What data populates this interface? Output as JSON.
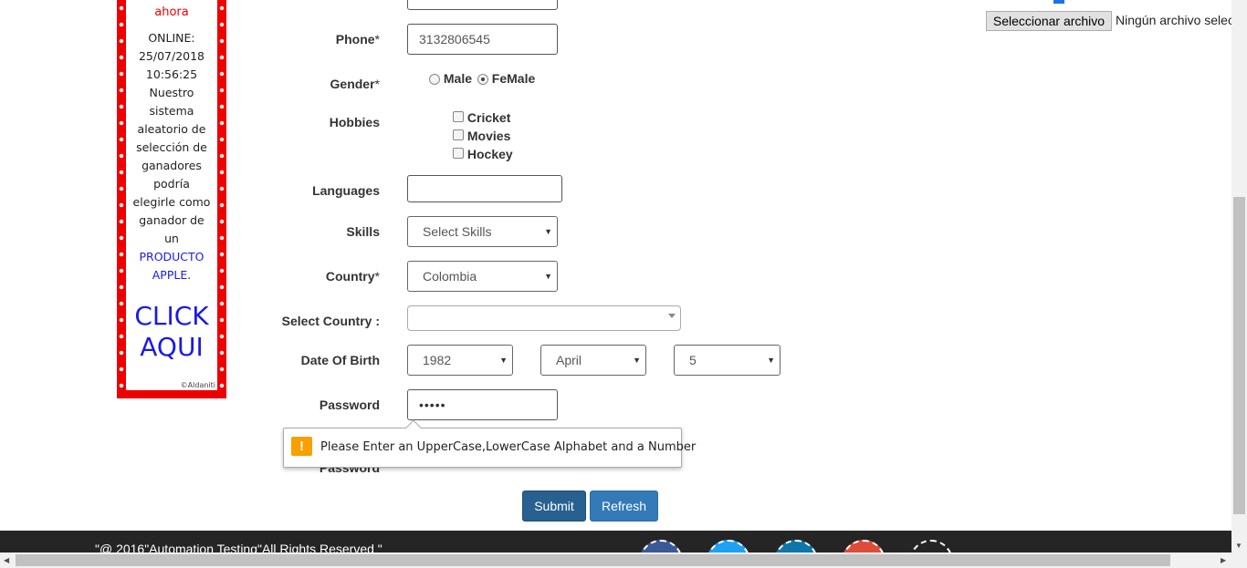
{
  "ad": {
    "line_red": "ahora",
    "lines": [
      "ONLINE:",
      "25/07/2018",
      "10:56:25",
      "Nuestro",
      "sistema",
      "aleatorio de",
      "selección de",
      "ganadores",
      "podría",
      "elegirle como",
      "ganador de",
      "un"
    ],
    "link": [
      "PRODUCTO",
      "APPLE"
    ],
    "link_suffix": ".",
    "cta": [
      "CLICK",
      "AQUI"
    ],
    "copyright": "©Aldaniti"
  },
  "file_upload": {
    "button": "Seleccionar archivo",
    "status": "Ningún archivo seleccionado"
  },
  "form": {
    "phone": {
      "label": "Phone",
      "required": "*",
      "value": "3132806545"
    },
    "gender": {
      "label": "Gender",
      "required": "*",
      "options": [
        "Male",
        "FeMale"
      ],
      "selected": "FeMale"
    },
    "hobbies": {
      "label": "Hobbies",
      "options": [
        "Cricket",
        "Movies",
        "Hockey"
      ]
    },
    "languages": {
      "label": "Languages",
      "value": ""
    },
    "skills": {
      "label": "Skills",
      "value": "Select Skills"
    },
    "country": {
      "label": "Country",
      "required": "*",
      "value": "Colombia"
    },
    "select_country": {
      "label": "Select Country :",
      "value": ""
    },
    "dob": {
      "label": "Date Of Birth",
      "year": "1982",
      "month": "April",
      "day": "5"
    },
    "password": {
      "label": "Password",
      "value": "•••••"
    },
    "confirm_password": {
      "label": "Password"
    },
    "tooltip": {
      "icon": "!",
      "message": "Please Enter an UpperCase,LowerCase Alphabet and a Number"
    },
    "submit": "Submit",
    "refresh": "Refresh"
  },
  "footer": {
    "text": "\"@ 2016\"Automation Testing\"All Rights Reserved \""
  },
  "colors": {
    "primary": "#337ab7",
    "submit": "#286090",
    "ad_red": "#ee0000",
    "warning": "#f7a000",
    "footer": "#252525"
  }
}
